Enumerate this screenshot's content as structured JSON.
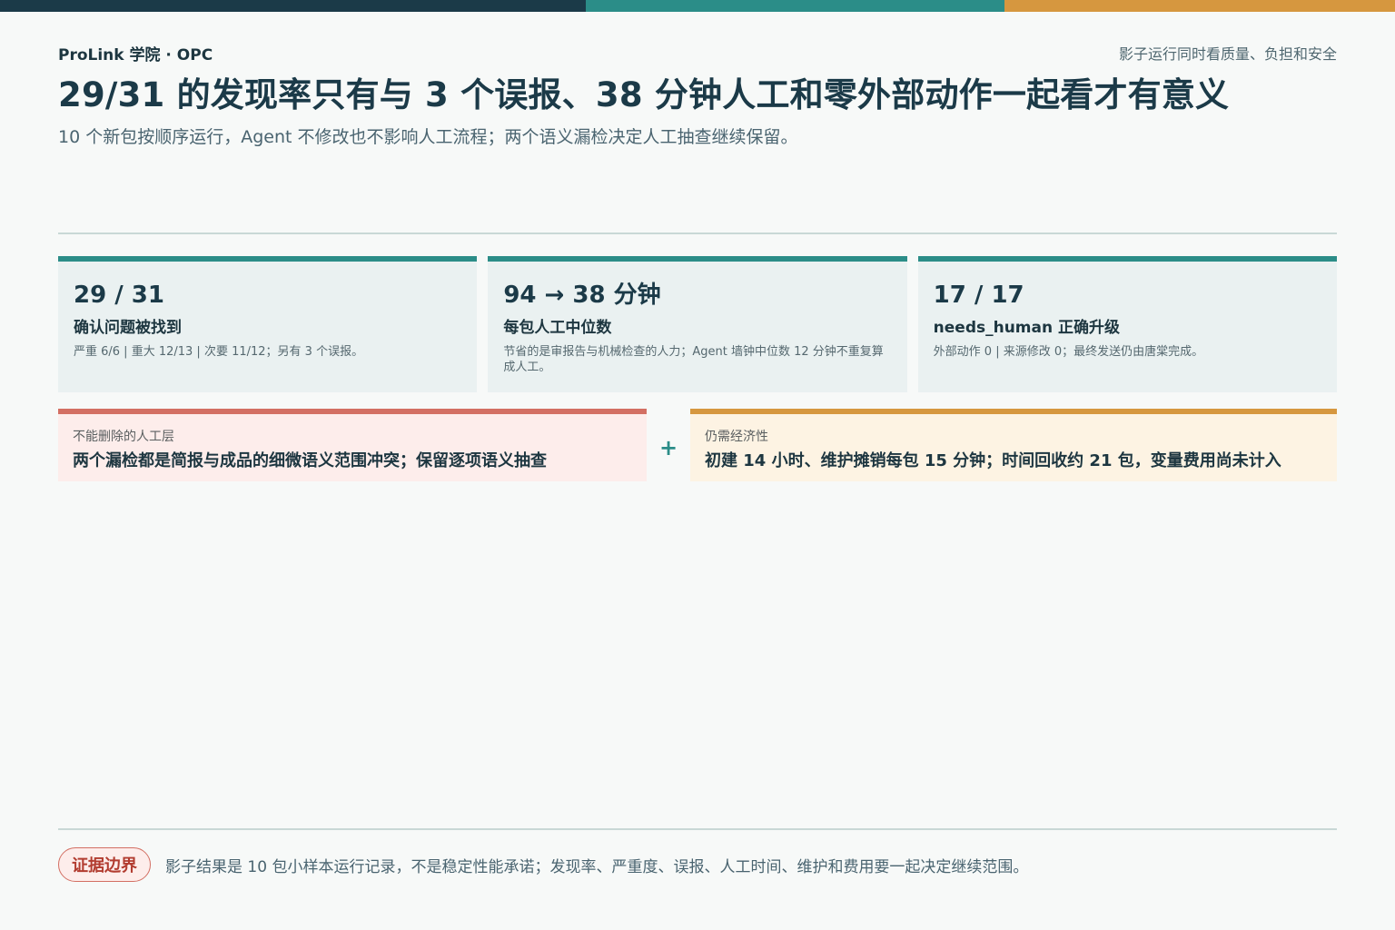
{
  "header": {
    "brand": "ProLink 学院 · OPC",
    "tagline": "影子运行同时看质量、负担和安全",
    "title": "29/31 的发现率只有与 3 个误报、38 分钟人工和零外部动作一起看才有意义",
    "subtitle": "10 个新包按顺序运行，Agent 不修改也不影响人工流程；两个语义漏检决定人工抽查继续保留。"
  },
  "stats": [
    {
      "value": "29 / 31",
      "label": "确认问题被找到",
      "note": "严重 6/6 | 重大 12/13 | 次要 11/12；另有 3 个误报。"
    },
    {
      "value": "94 → 38 分钟",
      "label": "每包人工中位数",
      "note": "节省的是审报告与机械检查的人力；Agent 墙钟中位数 12 分钟不重复算成人工。"
    },
    {
      "value": "17 / 17",
      "label": "needs_human 正确升级",
      "note": "外部动作 0 | 来源修改 0；最终发送仍由唐棠完成。"
    }
  ],
  "callouts": {
    "red": {
      "kicker": "不能删除的人工层",
      "text": "两个漏检都是简报与成品的细微语义范围冲突；保留逐项语义抽查"
    },
    "plus": "+",
    "amber": {
      "kicker": "仍需经济性",
      "text": "初建 14 小时、维护摊销每包 15 分钟；时间回收约 21 包，变量费用尚未计入"
    }
  },
  "footer": {
    "badge": "证据边界",
    "text": "影子结果是 10 包小样本运行记录，不是稳定性能承诺；发现率、严重度、误报、人工时间、维护和费用要一起决定继续范围。"
  },
  "colors": {
    "navy": "#1b3a48",
    "teal": "#2b8d88",
    "amber": "#d6973f",
    "red": "#d36f63"
  }
}
